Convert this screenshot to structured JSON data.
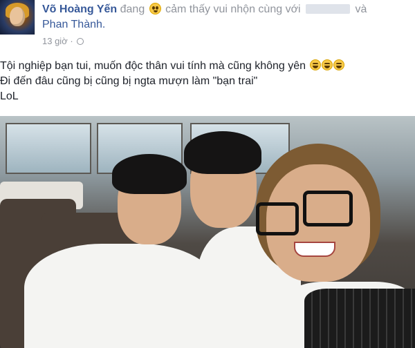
{
  "header": {
    "author": "Võ Hoàng Yến",
    "feeling_prefix": "đang",
    "feeling": "cảm thấy vui nhộn cùng với",
    "connector": "và",
    "tagged": "Phan Thành."
  },
  "meta": {
    "time": "13 giờ ·",
    "privacy_icon": "globe-icon"
  },
  "post": {
    "lines": [
      "Tội nghiệp bạn tui, muốn độc thân vui tính mà cũng không yên",
      "Đi đến đâu cũng bị cũng bị ngta mượn làm \"bạn trai\"",
      "LoL"
    ],
    "emoji": "laughing-tears-emoji"
  },
  "colors": {
    "link": "#365899",
    "muted": "#90949c",
    "text": "#1d2129"
  }
}
